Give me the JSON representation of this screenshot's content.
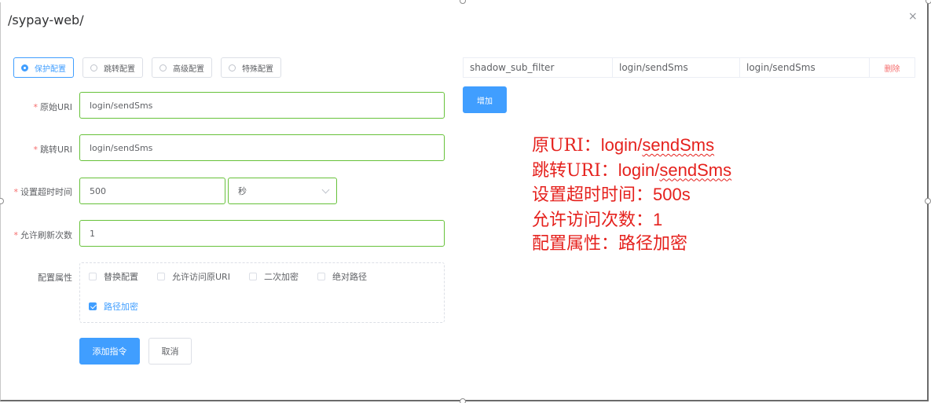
{
  "dialog": {
    "title": "/sypay-web/",
    "close_glyph": "×"
  },
  "config_tabs": [
    {
      "label": "保护配置",
      "selected": true
    },
    {
      "label": "跳转配置",
      "selected": false
    },
    {
      "label": "高级配置",
      "selected": false
    },
    {
      "label": "特殊配置",
      "selected": false
    }
  ],
  "form": {
    "required_mark": "*",
    "original_uri": {
      "label": "原始URI",
      "value": "login/sendSms"
    },
    "redirect_uri": {
      "label": "跳转URI",
      "value": "login/sendSms"
    },
    "timeout": {
      "label": "设置超时时间",
      "value": "500",
      "unit": "秒"
    },
    "refresh_count": {
      "label": "允许刷新次数",
      "value": "1"
    },
    "attributes": {
      "label": "配置属性",
      "options": [
        {
          "label": "替换配置",
          "checked": false
        },
        {
          "label": "允许访问原URI",
          "checked": false
        },
        {
          "label": "二次加密",
          "checked": false
        },
        {
          "label": "绝对路径",
          "checked": false
        },
        {
          "label": "路径加密",
          "checked": true
        }
      ]
    },
    "submit_label": "添加指令",
    "cancel_label": "取消"
  },
  "rules_table": {
    "rows": [
      {
        "type": "shadow_sub_filter",
        "from": "login/sendSms",
        "to": "login/sendSms",
        "action": "删除"
      }
    ],
    "add_label": "增加"
  },
  "annotation": {
    "line1_prefix": "原URI：",
    "line1_value_a": "login/",
    "line1_value_b": "sendSms",
    "line2_prefix": "跳转URI：",
    "line2_value_a": "login/",
    "line2_value_b": "sendSms",
    "line3_prefix": "设置超时时间：",
    "line3_value": "500s",
    "line4_prefix": "允许访问次数：",
    "line4_value": "1",
    "line5": "配置属性：路径加密"
  },
  "colors": {
    "primary": "#409eff",
    "success_border": "#67c23a",
    "danger": "#f56c6c",
    "annotation_red": "#e5211d"
  }
}
